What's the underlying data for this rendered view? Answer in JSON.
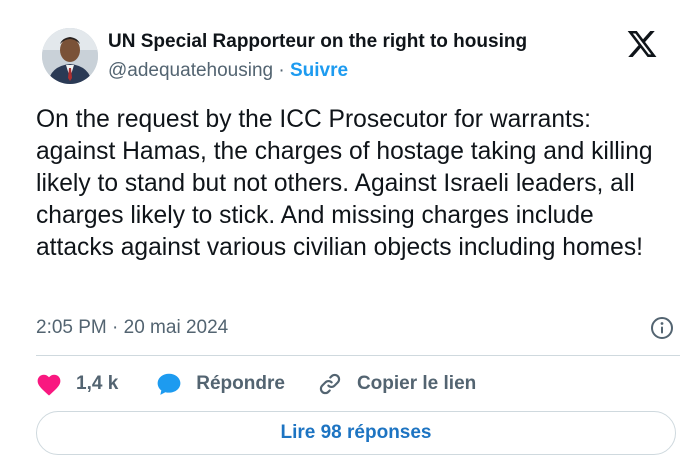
{
  "author": {
    "display_name": "UN Special Rapporteur on the right to housing",
    "handle": "@adequatehousing",
    "separator": "·",
    "follow_label": "Suivre"
  },
  "tweet": {
    "text": "On the request by the ICC Prosecutor for warrants: against Hamas, the charges of hostage taking and killing likely to stand but not others. Against Israeli leaders, all charges likely to stick. And missing charges include attacks against various civilian objects including homes!",
    "timestamp": "2:05 PM · 20 mai 2024"
  },
  "actions": {
    "like_count": "1,4 k",
    "reply_label": "Répondre",
    "copy_link_label": "Copier le lien"
  },
  "read_replies_label": "Lire 98 réponses",
  "icons": {
    "logo": "x-logo-icon",
    "info": "info-icon",
    "like": "heart-icon",
    "reply": "speech-bubble-icon",
    "copy": "link-icon"
  },
  "colors": {
    "accent": "#1d9bf0",
    "like": "#f91880",
    "text_secondary": "#536471"
  }
}
